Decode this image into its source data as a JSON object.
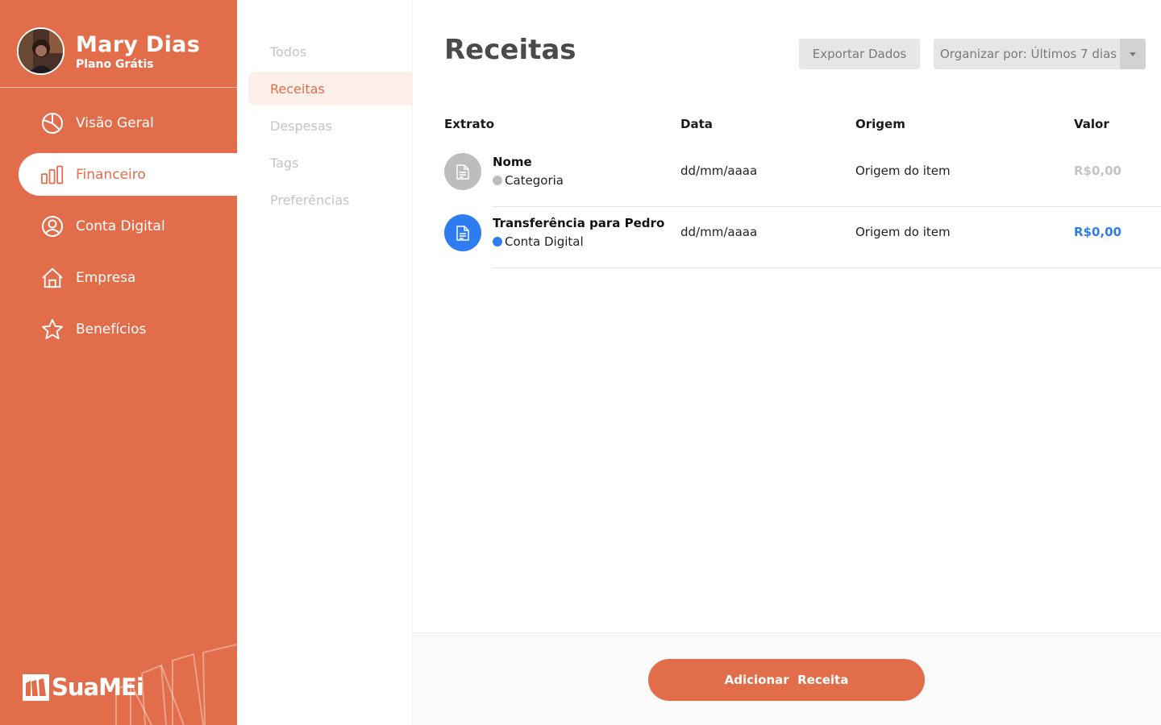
{
  "profile": {
    "name": "Mary Dias",
    "plan": "Plano Grátis"
  },
  "nav": {
    "items": [
      {
        "label": "Visão Geral",
        "icon": "pie-chart-icon"
      },
      {
        "label": "Financeiro",
        "icon": "bar-chart-icon",
        "active": true
      },
      {
        "label": "Conta Digital",
        "icon": "user-circle-icon"
      },
      {
        "label": "Empresa",
        "icon": "home-icon"
      },
      {
        "label": "Benefícios",
        "icon": "star-icon"
      }
    ]
  },
  "brand": {
    "name": "SuaMEi"
  },
  "subnav": {
    "items": [
      {
        "label": "Todos"
      },
      {
        "label": "Receitas",
        "active": true
      },
      {
        "label": "Despesas"
      },
      {
        "label": "Tags"
      },
      {
        "label": "Preferências"
      }
    ]
  },
  "main": {
    "title": "Receitas",
    "export_label": "Exportar Dados",
    "sort_label": "Organizar por: Últimos 7 dias",
    "columns": [
      "Extrato",
      "Data",
      "Origem",
      "Valor"
    ],
    "rows": [
      {
        "name": "Nome",
        "category": "Categoria",
        "date": "dd/mm/aaaa",
        "origin": "Origem do item",
        "value": "R$0,00",
        "color": "#bdbdbd",
        "value_color": "#c4c4c4"
      },
      {
        "name": "Transferência para Pedro",
        "category": "Conta Digital",
        "date": "dd/mm/aaaa",
        "origin": "Origem do item",
        "value": "R$0,00",
        "color": "#2f7cf0",
        "value_color": "#2f7cf0"
      }
    ],
    "add_label": "Adicionar  Receita"
  },
  "colors": {
    "accent": "#e26d4a",
    "blue": "#2f7cf0",
    "gray": "#bdbdbd"
  }
}
